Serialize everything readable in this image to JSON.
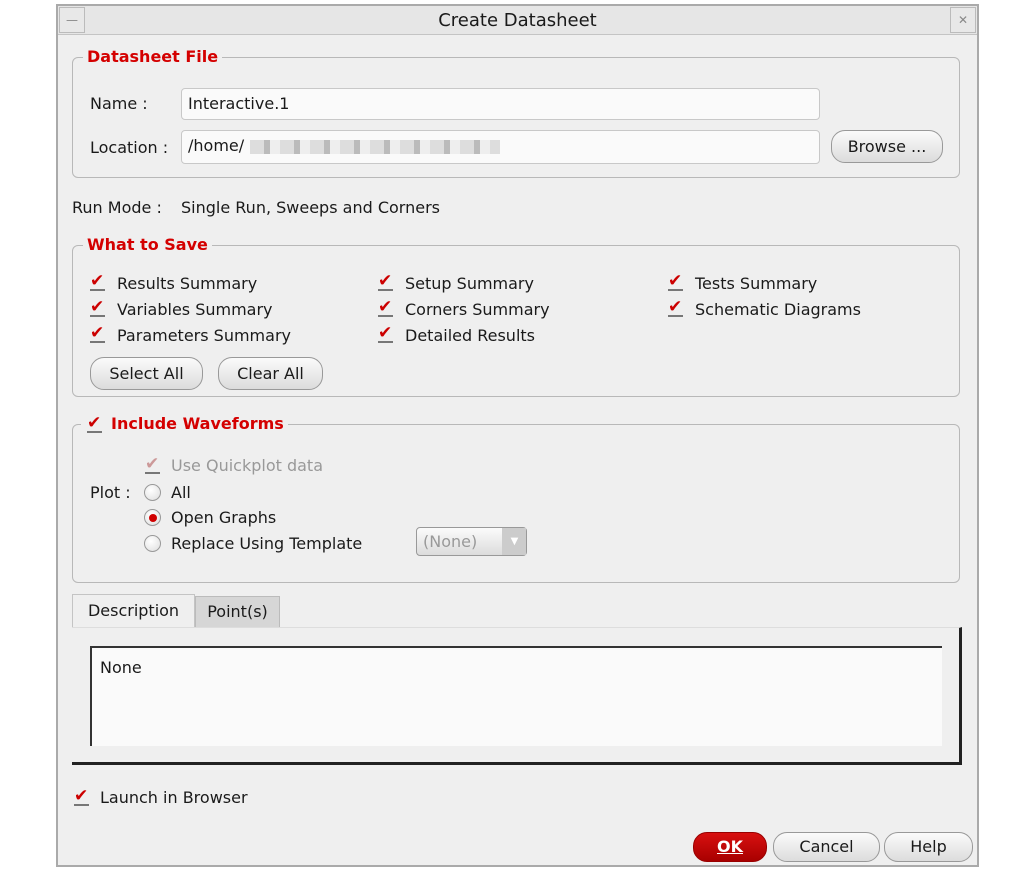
{
  "window": {
    "title": "Create Datasheet",
    "minimize_icon": "minimize-icon",
    "close_icon": "close-icon"
  },
  "datasheet_file": {
    "title": "Datasheet File",
    "name_label": "Name :",
    "name_value": "Interactive.1",
    "location_label": "Location :",
    "location_value": "/home/",
    "browse_label": "Browse ..."
  },
  "run_mode": {
    "label": "Run Mode :",
    "value": "Single Run, Sweeps and Corners"
  },
  "what_to_save": {
    "title": "What to Save",
    "items": [
      {
        "label": "Results Summary",
        "checked": true
      },
      {
        "label": "Variables Summary",
        "checked": true
      },
      {
        "label": "Parameters Summary",
        "checked": true
      },
      {
        "label": "Setup Summary",
        "checked": true
      },
      {
        "label": "Corners Summary",
        "checked": true
      },
      {
        "label": "Detailed Results",
        "checked": true
      },
      {
        "label": "Tests Summary",
        "checked": true
      },
      {
        "label": "Schematic Diagrams",
        "checked": true
      }
    ],
    "select_all": "Select All",
    "clear_all": "Clear All"
  },
  "waveforms": {
    "title": "Include Waveforms",
    "checked": true,
    "quickplot_label": "Use Quickplot data",
    "plot_label": "Plot :",
    "options": [
      "All",
      "Open Graphs",
      "Replace Using Template"
    ],
    "selected": "Open Graphs",
    "template_value": "(None)"
  },
  "tabs": {
    "items": [
      "Description",
      "Point(s)"
    ],
    "active": "Description",
    "description_text": "None"
  },
  "launch_in_browser": {
    "label": "Launch in Browser",
    "checked": true
  },
  "buttons": {
    "ok": "OK",
    "cancel": "Cancel",
    "help": "Help"
  },
  "colors": {
    "accent": "#d40000",
    "ok_button": "#c00000"
  }
}
